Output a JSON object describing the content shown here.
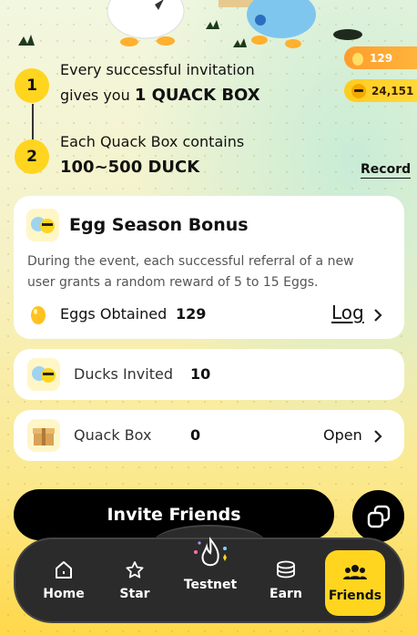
{
  "counters": {
    "eggs": "129",
    "ducks": "24,151"
  },
  "steps": [
    {
      "number": "1",
      "line1": "Every successful invitation",
      "line2_prefix": "gives you ",
      "line2_bold": "1 QUACK BOX"
    },
    {
      "number": "2",
      "line1": "Each Quack Box contains",
      "line2_bold": "100~500 DUCK"
    }
  ],
  "record_label": "Record",
  "bonus": {
    "title": "Egg Season Bonus",
    "description": "During the event, each successful referral of a new user grants a random reward of 5 to 15 Eggs.",
    "eggs_label": "Eggs Obtained",
    "eggs_value": "129",
    "log_label": "Log"
  },
  "ducks_invited": {
    "label": "Ducks Invited",
    "value": "10"
  },
  "quack_box": {
    "label": "Quack Box",
    "value": "0",
    "action": "Open"
  },
  "invite_label": "Invite Friends",
  "nav": [
    {
      "id": "home",
      "label": "Home",
      "icon": "home-icon"
    },
    {
      "id": "star",
      "label": "Star",
      "icon": "star-icon"
    },
    {
      "id": "testnet",
      "label": "Testnet",
      "icon": "flame-icon"
    },
    {
      "id": "earn",
      "label": "Earn",
      "icon": "coins-icon"
    },
    {
      "id": "friends",
      "label": "Friends",
      "icon": "friends-icon",
      "active": true
    }
  ],
  "colors": {
    "accent": "#ffd51f",
    "dark": "#000000",
    "egg_counter": "#ff9d2b"
  }
}
